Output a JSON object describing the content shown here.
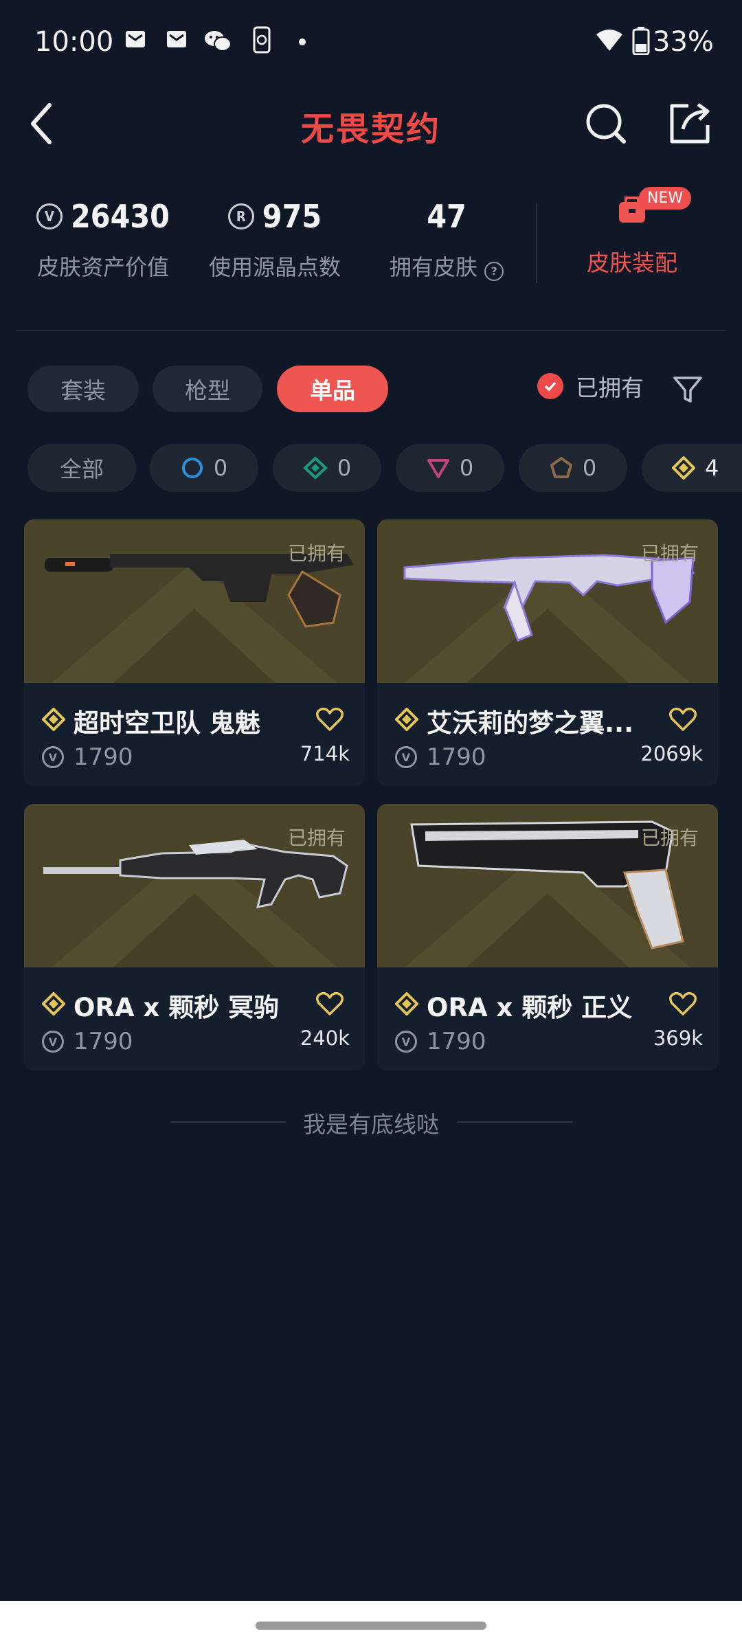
{
  "status_bar": {
    "time": "10:00",
    "battery": "33%"
  },
  "header": {
    "title": "无畏契约"
  },
  "stats": [
    {
      "value": "26430",
      "label": "皮肤资产价值",
      "icon": "valorant-points-icon"
    },
    {
      "value": "975",
      "label": "使用源晶点数",
      "icon": "radianite-icon"
    },
    {
      "value": "47",
      "label": "拥有皮肤",
      "icon": "help-icon"
    }
  ],
  "outfit": {
    "label": "皮肤装配",
    "badge": "NEW"
  },
  "tabs": [
    {
      "label": "套装",
      "active": false
    },
    {
      "label": "枪型",
      "active": false
    },
    {
      "label": "单品",
      "active": true
    }
  ],
  "owned_toggle": {
    "label": "已拥有",
    "checked": true
  },
  "rarity_filters": [
    {
      "label": "全部"
    },
    {
      "count": "0",
      "icon": "select-tier-icon",
      "color": "#2f8fd6"
    },
    {
      "count": "0",
      "icon": "deluxe-tier-icon",
      "color": "#1a9b7c"
    },
    {
      "count": "0",
      "icon": "premium-tier-icon",
      "color": "#c2437a"
    },
    {
      "count": "0",
      "icon": "ultra-tier-icon",
      "color": "#8a6a4a"
    },
    {
      "count": "4",
      "icon": "exclusive-tier-icon",
      "color": "#e3c55a"
    }
  ],
  "cards": [
    {
      "name": "超时空卫队 鬼魅",
      "price": "1790",
      "likes": "714k",
      "owned_label": "已拥有"
    },
    {
      "name": "艾沃莉的梦之翼...",
      "price": "1790",
      "likes": "2069k",
      "owned_label": "已拥有"
    },
    {
      "name": "ORA x 颗秒 冥驹",
      "price": "1790",
      "likes": "240k",
      "owned_label": "已拥有"
    },
    {
      "name": "ORA x 颗秒 正义",
      "price": "1790",
      "likes": "369k",
      "owned_label": "已拥有"
    }
  ],
  "footer": {
    "text": "我是有底线哒"
  },
  "colors": {
    "accent": "#ef5551",
    "background": "#101827",
    "card_image_bg": "#4a452a"
  }
}
